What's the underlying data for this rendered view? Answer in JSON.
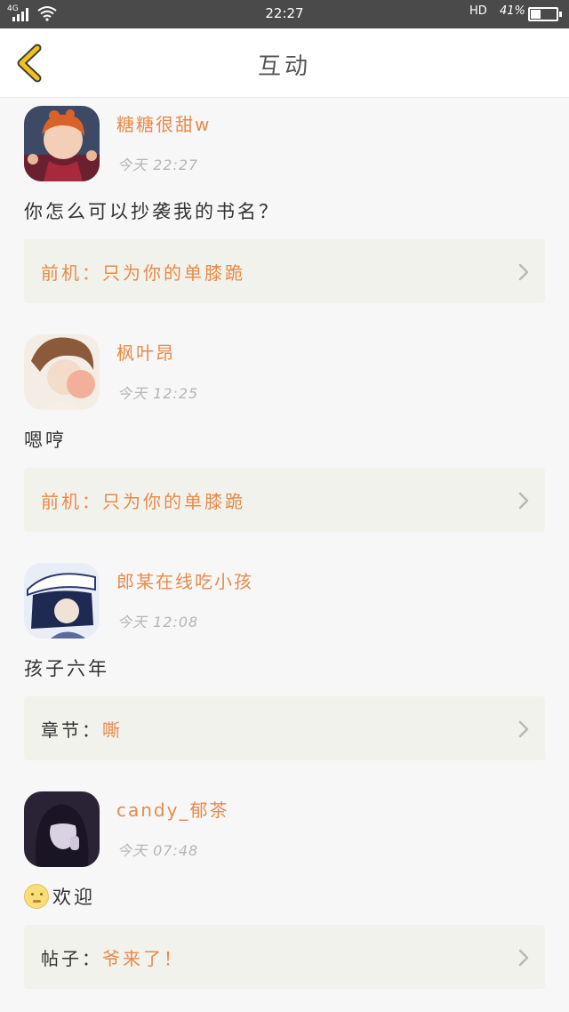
{
  "status_bar": {
    "network": "4G",
    "time": "22:27",
    "hd_label": "HD",
    "battery_percent": "41%",
    "battery_level": 0.41
  },
  "header": {
    "title": "互动"
  },
  "items": [
    {
      "username": "糖糖很甜w",
      "timestamp": "今天 22:27",
      "message": "你怎么可以抄袭我的书名？",
      "ref_label": "前机：",
      "ref_value": "只为你的单膝跪"
    },
    {
      "username": "枫叶昂",
      "timestamp": "今天 12:25",
      "message": "嗯哼",
      "ref_label": "前机：",
      "ref_value": "只为你的单膝跪"
    },
    {
      "username": "郎某在线吃小孩",
      "timestamp": "今天 12:08",
      "message": "孩子六年",
      "ref_label": "章节：",
      "ref_value": "嘶"
    },
    {
      "username": "candy_郁茶",
      "timestamp": "今天 07:48",
      "message": "欢迎",
      "ref_label": "帖子：",
      "ref_value": "爷来了！"
    }
  ],
  "colors": {
    "accent": "#e88a4a",
    "status_bar_bg": "#4a4a4a",
    "back_icon": "#f2c21a",
    "card_bg": "#f2f2ec"
  },
  "icons": {
    "back": "chevron-left-icon",
    "item_arrow": "chevron-right-icon",
    "emoji": "smiley-emoji-icon"
  }
}
